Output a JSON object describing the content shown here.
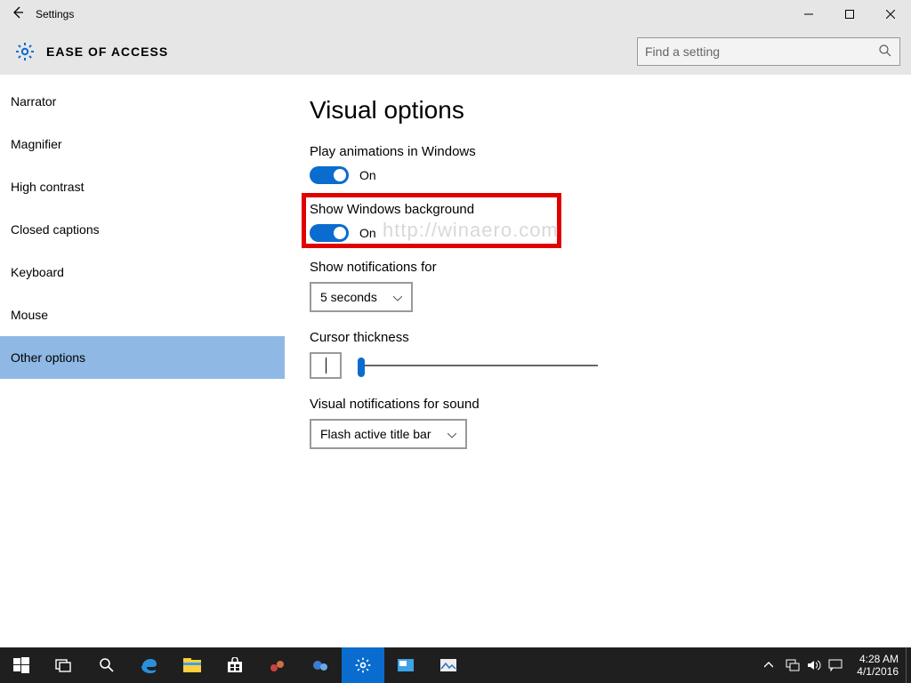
{
  "window": {
    "title": "Settings",
    "breadcrumb": "EASE OF ACCESS",
    "search_placeholder": "Find a setting"
  },
  "sidebar": {
    "items": [
      {
        "label": "Narrator"
      },
      {
        "label": "Magnifier"
      },
      {
        "label": "High contrast"
      },
      {
        "label": "Closed captions"
      },
      {
        "label": "Keyboard"
      },
      {
        "label": "Mouse"
      },
      {
        "label": "Other options"
      }
    ],
    "selected_index": 6
  },
  "page": {
    "title": "Visual options",
    "animations": {
      "label": "Play animations in Windows",
      "state": "On"
    },
    "background": {
      "label": "Show Windows background",
      "state": "On"
    },
    "notif_for": {
      "label": "Show notifications for",
      "value": "5 seconds"
    },
    "cursor": {
      "label": "Cursor thickness"
    },
    "visual_notif": {
      "label": "Visual notifications for sound",
      "value": "Flash active title bar"
    }
  },
  "watermark": "http://winaero.com",
  "taskbar": {
    "time": "4:28 AM",
    "date": "4/1/2016"
  }
}
